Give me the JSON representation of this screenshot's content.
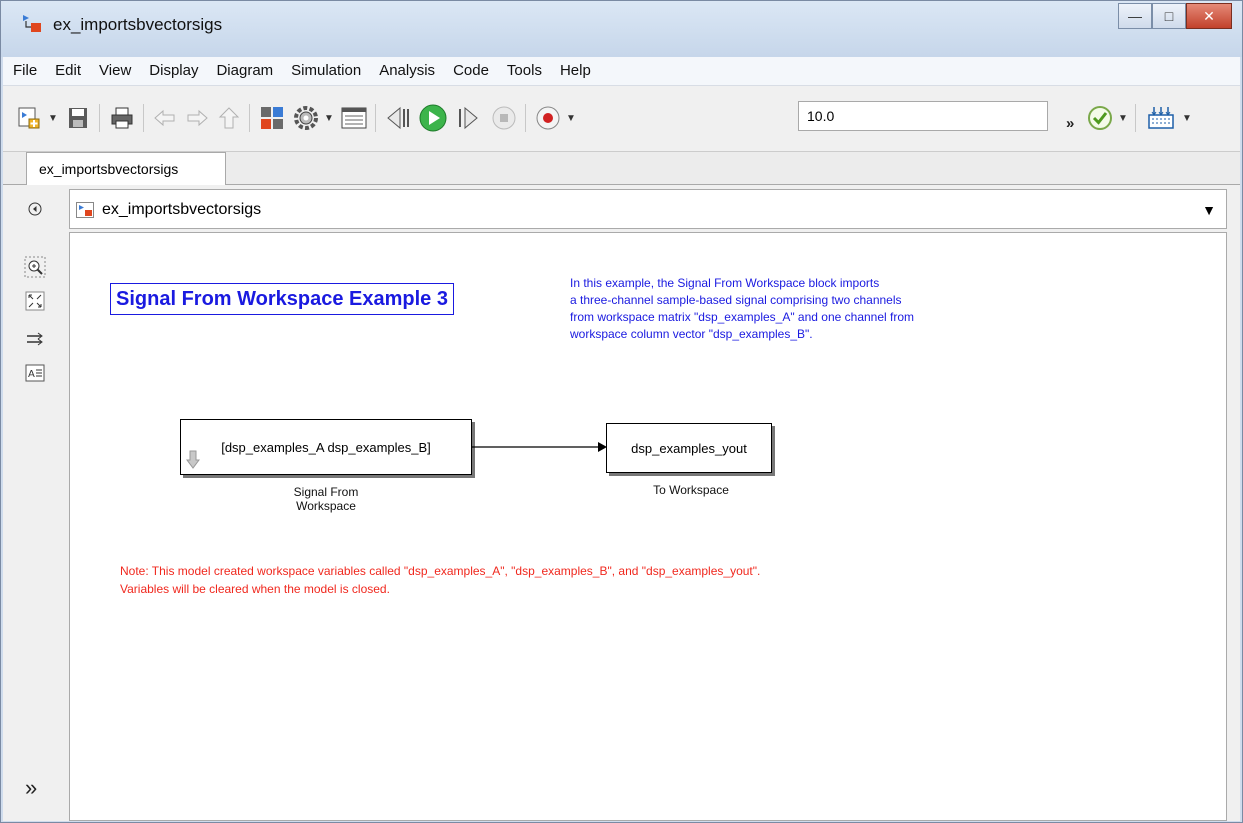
{
  "window": {
    "title": "ex_importsbvectorsigs",
    "minimize": "—",
    "maximize": "□",
    "close": "✕"
  },
  "menu": [
    "File",
    "Edit",
    "View",
    "Display",
    "Diagram",
    "Simulation",
    "Analysis",
    "Code",
    "Tools",
    "Help"
  ],
  "toolbar": {
    "stop_time": "10.0",
    "overflow": "»",
    "icons": [
      "new-model-icon",
      "save-icon",
      "print-icon",
      "back-icon",
      "forward-icon",
      "up-icon",
      "library-browser-icon",
      "model-config-icon",
      "model-explorer-icon",
      "step-back-icon",
      "run-icon",
      "step-forward-icon",
      "stop-icon",
      "record-icon",
      "model-advisor-icon",
      "build-icon"
    ]
  },
  "tab": {
    "label": "ex_importsbvectorsigs"
  },
  "address": {
    "path": "ex_importsbvectorsigs"
  },
  "left_panel": {
    "more": "»"
  },
  "canvas": {
    "title": "Signal From Workspace Example 3",
    "description": [
      "In this example, the Signal From Workspace block imports",
      "a three-channel sample-based signal comprising two channels",
      "from workspace matrix \"dsp_examples_A\" and one channel from",
      "workspace column vector \"dsp_examples_B\"."
    ],
    "source_block": {
      "text": "[dsp_examples_A dsp_examples_B]",
      "label_line1": "Signal From",
      "label_line2": "Workspace"
    },
    "sink_block": {
      "text": "dsp_examples_yout",
      "label": "To Workspace"
    },
    "note": [
      "Note: This model created workspace variables called \"dsp_examples_A\", \"dsp_examples_B\", and \"dsp_examples_yout\".",
      "Variables will be cleared when the model is closed."
    ]
  }
}
